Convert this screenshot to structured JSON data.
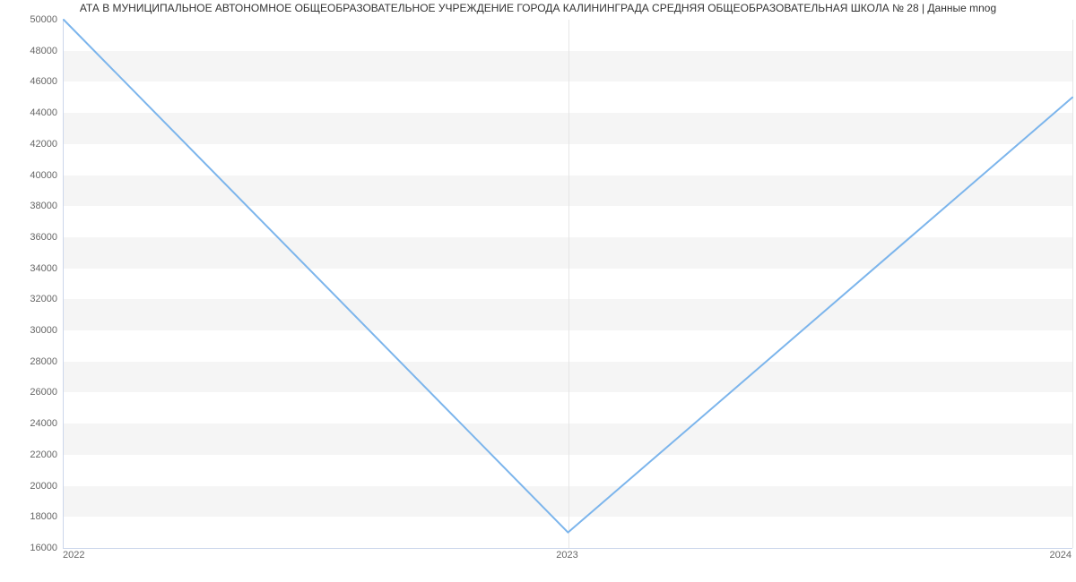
{
  "title": "АТА В МУНИЦИПАЛЬНОЕ АВТОНОМНОЕ ОБЩЕОБРАЗОВАТЕЛЬНОЕ УЧРЕЖДЕНИЕ ГОРОДА КАЛИНИНГРАДА СРЕДНЯЯ ОБЩЕОБРАЗОВАТЕЛЬНАЯ ШКОЛА № 28 | Данные mnog",
  "chart_data": {
    "type": "line",
    "categories": [
      "2022",
      "2023",
      "2024"
    ],
    "values": [
      50000,
      17000,
      45000
    ],
    "title": "АТА В МУНИЦИПАЛЬНОЕ АВТОНОМНОЕ ОБЩЕОБРАЗОВАТЕЛЬНОЕ УЧРЕЖДЕНИЕ ГОРОДА КАЛИНИНГРАДА СРЕДНЯЯ ОБЩЕОБРАЗОВАТЕЛЬНАЯ ШКОЛА № 28 | Данные mnog",
    "xlabel": "",
    "ylabel": "",
    "ylim": [
      16000,
      50000
    ],
    "yticks": [
      16000,
      18000,
      20000,
      22000,
      24000,
      26000,
      28000,
      30000,
      32000,
      34000,
      36000,
      38000,
      40000,
      42000,
      44000,
      46000,
      48000,
      50000
    ]
  },
  "colors": {
    "line": "#7cb5ec",
    "band": "#f5f5f5",
    "axis": "#ccd6eb"
  }
}
